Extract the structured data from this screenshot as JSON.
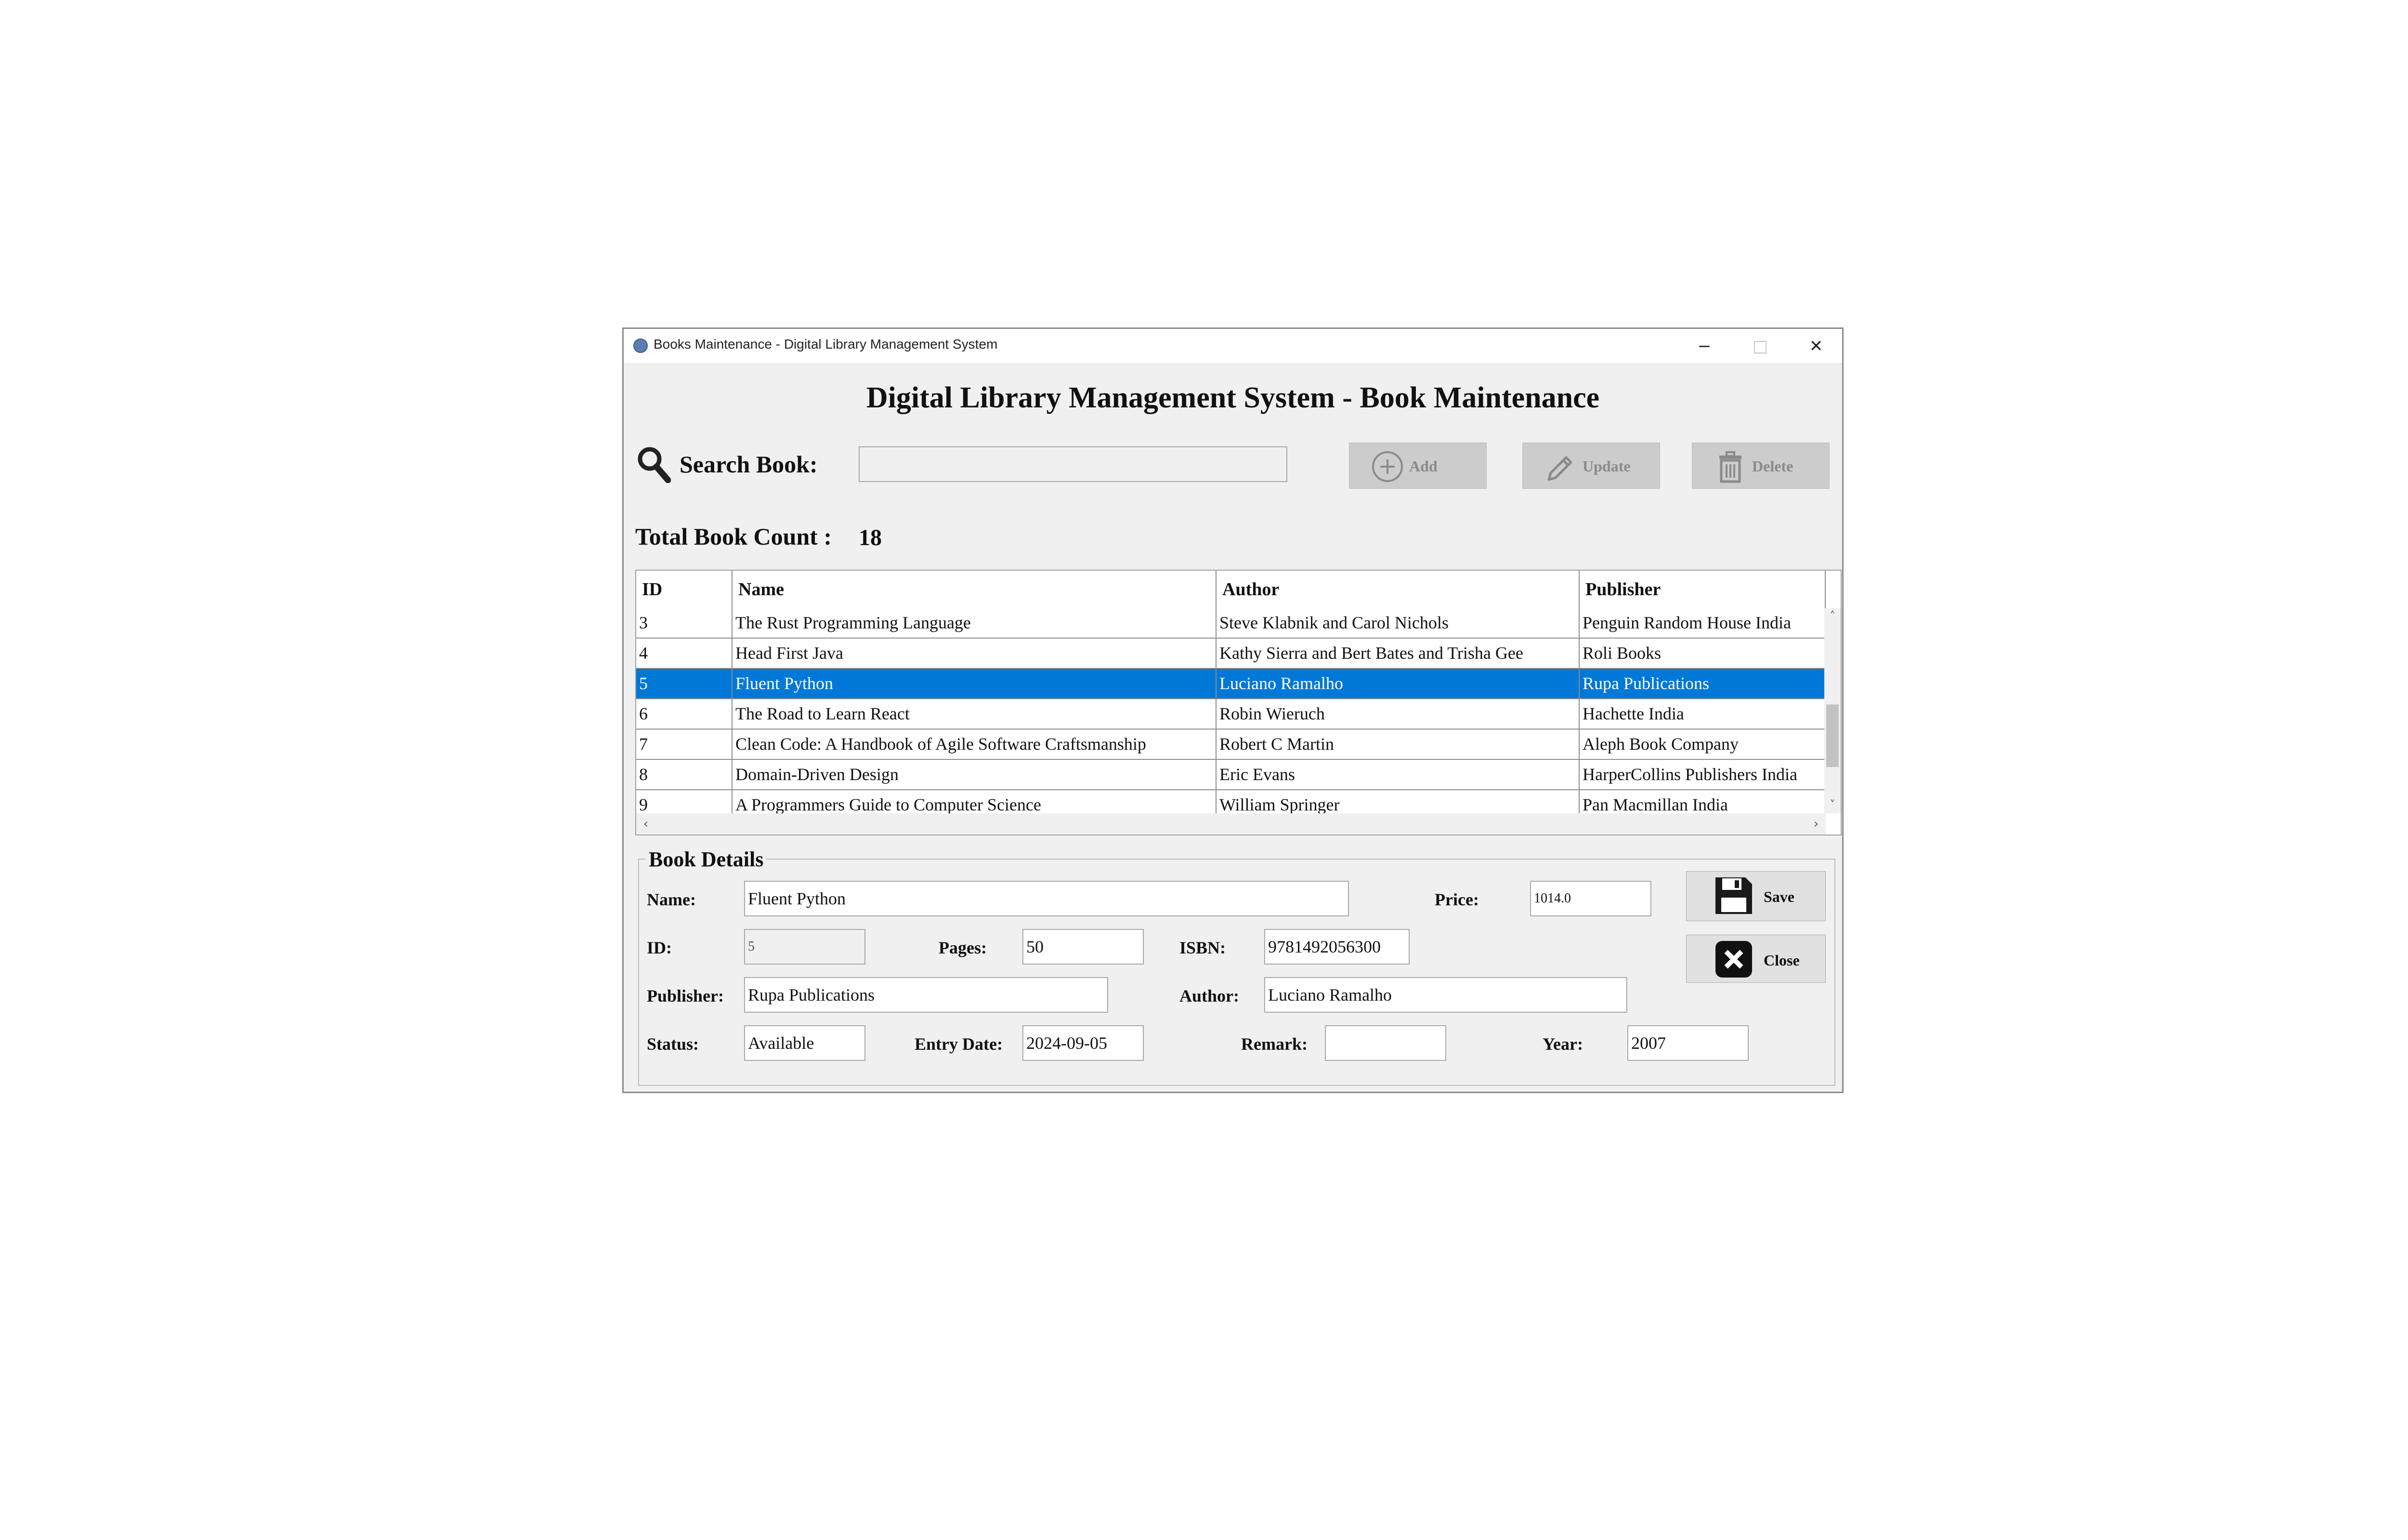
{
  "window": {
    "title": "Books Maintenance - Digital Library Management System",
    "controls": {
      "minimize": "−",
      "maximize": "□",
      "close": "✕"
    }
  },
  "heading": "Digital Library Management System - Book Maintenance",
  "search": {
    "label": "Search Book:",
    "value": ""
  },
  "toolbar": {
    "add_label": "Add",
    "update_label": "Update",
    "delete_label": "Delete"
  },
  "count": {
    "label": "Total Book Count :",
    "value": "18"
  },
  "table": {
    "columns": [
      "ID",
      "Name",
      "Author",
      "Publisher"
    ],
    "rows": [
      [
        "3",
        "The Rust Programming Language",
        "Steve Klabnik and Carol Nichols",
        "Penguin Random House India"
      ],
      [
        "4",
        "Head First Java",
        "Kathy Sierra and Bert Bates and Trisha Gee",
        "Roli Books"
      ],
      [
        "5",
        "Fluent Python",
        "Luciano Ramalho",
        "Rupa Publications"
      ],
      [
        "6",
        "The Road to Learn React",
        "Robin Wieruch",
        "Hachette India"
      ],
      [
        "7",
        "Clean Code: A Handbook of Agile Software Craftsmanship",
        "Robert C Martin",
        "Aleph Book Company"
      ],
      [
        "8",
        "Domain-Driven Design",
        "Eric Evans",
        "HarperCollins Publishers India"
      ],
      [
        "9",
        "A Programmers Guide to Computer Science",
        "William Springer",
        "Pan Macmillan India"
      ]
    ],
    "selected_row": 2,
    "scroll": {
      "up": "˄",
      "down": "˅",
      "left": "‹",
      "right": "›"
    }
  },
  "details": {
    "title": "Book Details",
    "name": {
      "label": "Name:",
      "value": "Fluent Python"
    },
    "price": {
      "label": "Price:",
      "value": "1014.0"
    },
    "id": {
      "label": "ID:",
      "value": "5"
    },
    "pages": {
      "label": "Pages:",
      "value": "50"
    },
    "isbn": {
      "label": "ISBN:",
      "value": "9781492056300"
    },
    "publisher": {
      "label": "Publisher:",
      "value": "Rupa Publications"
    },
    "author": {
      "label": "Author:",
      "value": "Luciano Ramalho"
    },
    "status": {
      "label": "Status:",
      "value": "Available"
    },
    "entry_date": {
      "label": "Entry Date:",
      "value": "2024-09-05"
    },
    "remark": {
      "label": "Remark:",
      "value": ""
    },
    "year": {
      "label": "Year:",
      "value": "2007"
    }
  },
  "actions": {
    "save_label": "Save",
    "close_label": "Close"
  },
  "colors": {
    "selection": "#0078d7",
    "window_bg": "#f0f0f0",
    "disabled_button": "#cccccc"
  }
}
